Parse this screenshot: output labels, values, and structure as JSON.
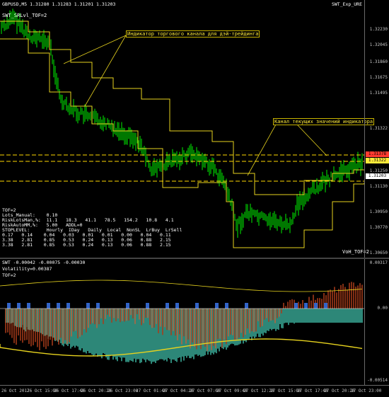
{
  "main": {
    "title": "GBPUSD,M5  1.31280 1.31283 1.31201 1.31203",
    "title_right": "SWT_Exp_URE",
    "indicator_label": "SWT_SRLvl_TOF=2",
    "annotation_1": "Индикатор торгового канала для дэй-трейдинга",
    "annotation_2": "Канал текущих значений индикатора",
    "bottom_right_label": "VoH_TOF=2",
    "price_ticks": [
      "1.32230",
      "1.32045",
      "1.31860",
      "1.31675",
      "1.31495",
      "1.31322",
      "1.31250",
      "1.31130",
      "1.30950",
      "1.30770",
      "1.30650"
    ],
    "price_flags": [
      {
        "text": "1.31378",
        "color": "#ff3b30"
      },
      {
        "text": "1.31322",
        "color": "#ffeb3b"
      },
      {
        "text": "1.31203",
        "color": "#ffffff"
      }
    ],
    "table": [
      "TOF=2",
      "Lots_Manual:    0.10",
      "RiskLotsMan,%:  11.1   18.3   41.1   78.5   154.2   10.8   4.1",
      "RiskAutoMM,%:   5.00   ADDL=0",
      "STOPLEVEL:      Hourly  IDay   Daily  Local  NonSL  LrBuy  LrSell",
      "0.17   0.14    0.04   0.03   0.01   0.01   0.00   0.04   0.11",
      "3.38   2.81    0.85   0.53   0.24   0.13   0.06   0.88   2.15",
      "3.38   2.81    0.85   0.53   0.24   0.13   0.06   0.88   2.15"
    ]
  },
  "sub": {
    "title": "SWT -0.00042 -0.00075 -0.00030",
    "volatility": "Volatility=0.00387",
    "tof": "TOF=2",
    "ticks": [
      "0.00317",
      "0.00",
      "-0.00514"
    ]
  },
  "time_axis": [
    "26 Oct 2017",
    "26 Oct 15:00",
    "26 Oct 17:40",
    "26 Oct 20:20",
    "26 Oct 23:00",
    "27 Oct 01:40",
    "27 Oct 04:20",
    "27 Oct 07:00",
    "27 Oct 09:40",
    "27 Oct 12:20",
    "27 Oct 15:00",
    "27 Oct 17:40",
    "27 Oct 20:20",
    "27 Oct 23:00"
  ],
  "colors": {
    "bull": "#00c800",
    "channel": "#e6d21e",
    "dashed": "#ffd700",
    "teal": "#3cb4a0",
    "rust": "#c8461e",
    "blue": "#3264c8"
  }
}
